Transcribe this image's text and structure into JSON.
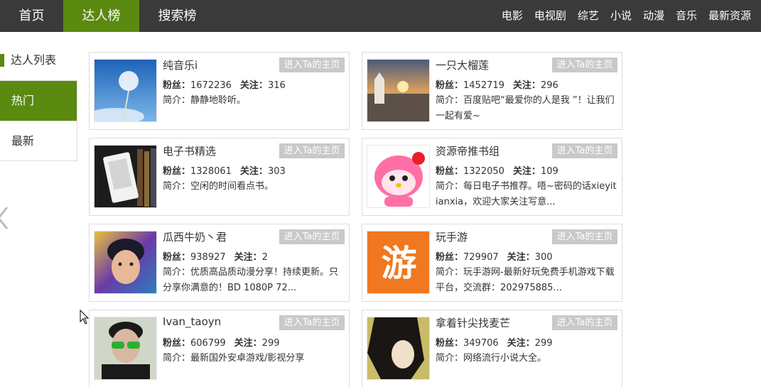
{
  "nav": {
    "tabs": [
      "首页",
      "达人榜",
      "搜索榜"
    ],
    "categories": [
      "电影",
      "电视剧",
      "综艺",
      "小说",
      "动漫",
      "音乐",
      "最新资源"
    ]
  },
  "sidebar": {
    "title": "达人列表",
    "items": [
      "热门",
      "最新"
    ]
  },
  "labels": {
    "fans": "粉丝：",
    "follow": "关注：",
    "bio": "简介：",
    "home_button": "进入Ta的主页"
  },
  "users": [
    {
      "name": "纯音乐i",
      "fans": "1672236",
      "follow": "316",
      "bio": "静静地聆听。",
      "avatar": "dandelion-sky-image"
    },
    {
      "name": "一只大榴莲",
      "fans": "1452719",
      "follow": "296",
      "bio": "百度贴吧“最爱你的人是我 ”！让我们一起有爱~",
      "avatar": "sunset-church-image"
    },
    {
      "name": "电子书精选",
      "fans": "1328061",
      "follow": "303",
      "bio": "空闲的时间看点书。",
      "avatar": "ereader-books-image"
    },
    {
      "name": "资源帝推书组",
      "fans": "1322050",
      "follow": "109",
      "bio": "每日电子书推荐。唔~密码的话xieyitianxia，欢迎大家关注写意...",
      "avatar": "hello-kitty-image"
    },
    {
      "name": "瓜西牛奶丶君",
      "fans": "938927",
      "follow": "2",
      "bio": "优质高品质动漫分享！持续更新。只分享你满意的！BD 1080P 72...",
      "avatar": "colorful-portrait-image"
    },
    {
      "name": "玩手游",
      "fans": "729907",
      "follow": "300",
      "bio": "玩手游网-最新好玩免费手机游戏下载平台，交流群：202975885...",
      "avatar": "orange-you-logo",
      "avatar_glyph": "游"
    },
    {
      "name": "Ivan_taoyn",
      "fans": "606799",
      "follow": "299",
      "bio": "最新国外安卓游戏/影视分享",
      "avatar": "sunglasses-man-image"
    },
    {
      "name": "拿着针尖找麦芒",
      "fans": "349706",
      "follow": "299",
      "bio": "网络流行小说大全。",
      "avatar": "dark-anime-girl-image"
    }
  ],
  "colors": {
    "nav_bg": "#3a3a3a",
    "accent": "#5a8a10",
    "button_bg": "#c9c9c9"
  }
}
